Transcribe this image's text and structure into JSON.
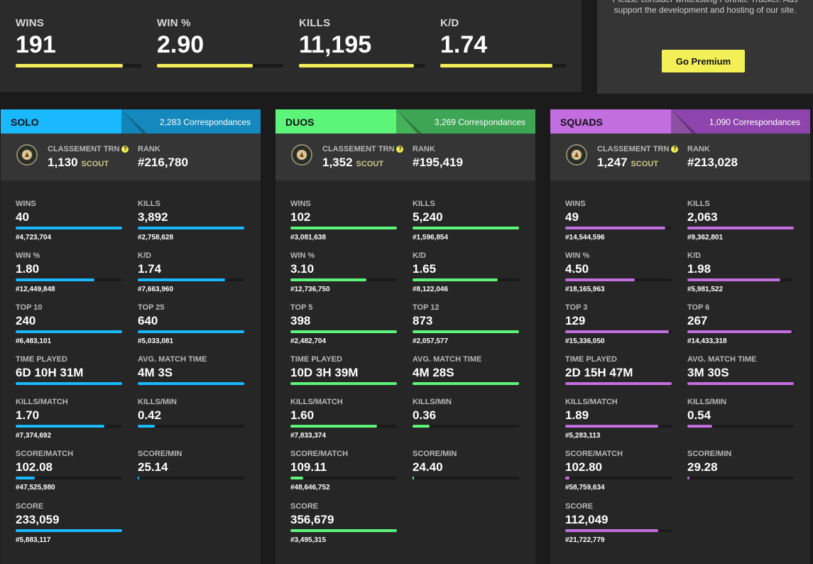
{
  "top": {
    "stats": [
      {
        "label": "WINS",
        "value": "191",
        "fill": 0.85
      },
      {
        "label": "WIN %",
        "value": "2.90",
        "fill": 0.76
      },
      {
        "label": "KILLS",
        "value": "11,195",
        "fill": 0.91
      },
      {
        "label": "K/D",
        "value": "1.74",
        "fill": 0.89
      }
    ]
  },
  "ad": {
    "text": "Please consider whitelisting Fortnite Tracker. Ads support the development and hosting of our site.",
    "button": "Go Premium"
  },
  "modes": [
    {
      "title": "SOLO",
      "count": "2,283 Correspondances",
      "color": "#19b8ff",
      "ribbon": "#1589bd",
      "trn_label": "CLASSEMENT TRN",
      "trn_value": "1,130",
      "trn_tier": "SCOUT",
      "rank_label": "RANK",
      "rank_value": "#216,780",
      "stats": [
        {
          "label": "WINS",
          "value": "40",
          "rank": "#4,723,704",
          "fill": 1.0
        },
        {
          "label": "KILLS",
          "value": "3,892",
          "rank": "#2,758,628",
          "fill": 1.0
        },
        {
          "label": "WIN %",
          "value": "1.80",
          "rank": "#12,449,848",
          "fill": 0.74
        },
        {
          "label": "K/D",
          "value": "1.74",
          "rank": "#7,663,960",
          "fill": 0.82
        },
        {
          "label": "TOP 10",
          "value": "240",
          "rank": "#6,483,101",
          "fill": 1.0
        },
        {
          "label": "TOP 25",
          "value": "640",
          "rank": "#5,033,081",
          "fill": 1.0
        },
        {
          "label": "TIME PLAYED",
          "value": "6D 10H 31M",
          "rank": "",
          "fill": 1.0
        },
        {
          "label": "AVG. MATCH TIME",
          "value": "4M 3S",
          "rank": "",
          "fill": 1.0
        },
        {
          "label": "KILLS/MATCH",
          "value": "1.70",
          "rank": "#7,374,692",
          "fill": 0.83
        },
        {
          "label": "KILLS/MIN",
          "value": "0.42",
          "rank": "",
          "fill": 0.16
        },
        {
          "label": "SCORE/MATCH",
          "value": "102.08",
          "rank": "#47,525,980",
          "fill": 0.18
        },
        {
          "label": "SCORE/MIN",
          "value": "25.14",
          "rank": "",
          "fill": 0.01
        },
        {
          "label": "SCORE",
          "value": "233,059",
          "rank": "#5,883,117",
          "fill": 1.0
        }
      ]
    },
    {
      "title": "DUOS",
      "count": "3,269 Correspondances",
      "color": "#5cf57a",
      "ribbon": "#3ea555",
      "trn_label": "CLASSEMENT TRN",
      "trn_value": "1,352",
      "trn_tier": "SCOUT",
      "rank_label": "RANK",
      "rank_value": "#195,419",
      "stats": [
        {
          "label": "WINS",
          "value": "102",
          "rank": "#3,081,638",
          "fill": 1.0
        },
        {
          "label": "KILLS",
          "value": "5,240",
          "rank": "#1,596,854",
          "fill": 1.0
        },
        {
          "label": "WIN %",
          "value": "3.10",
          "rank": "#12,736,750",
          "fill": 0.71
        },
        {
          "label": "K/D",
          "value": "1.65",
          "rank": "#8,122,046",
          "fill": 0.8
        },
        {
          "label": "TOP 5",
          "value": "398",
          "rank": "#2,482,704",
          "fill": 1.0
        },
        {
          "label": "TOP 12",
          "value": "873",
          "rank": "#2,057,577",
          "fill": 1.0
        },
        {
          "label": "TIME PLAYED",
          "value": "10D 3H 39M",
          "rank": "",
          "fill": 1.0
        },
        {
          "label": "AVG. MATCH TIME",
          "value": "4M 28S",
          "rank": "",
          "fill": 1.0
        },
        {
          "label": "KILLS/MATCH",
          "value": "1.60",
          "rank": "#7,833,374",
          "fill": 0.81
        },
        {
          "label": "KILLS/MIN",
          "value": "0.36",
          "rank": "",
          "fill": 0.16
        },
        {
          "label": "SCORE/MATCH",
          "value": "109.11",
          "rank": "#48,646,752",
          "fill": 0.12
        },
        {
          "label": "SCORE/MIN",
          "value": "24.40",
          "rank": "",
          "fill": 0.01
        },
        {
          "label": "SCORE",
          "value": "356,679",
          "rank": "#3,495,315",
          "fill": 1.0
        }
      ]
    },
    {
      "title": "SQUADS",
      "count": "1,090 Correspondances",
      "color": "#c36ee0",
      "ribbon": "#8e44ad",
      "trn_label": "CLASSEMENT TRN",
      "trn_value": "1,247",
      "trn_tier": "SCOUT",
      "rank_label": "RANK",
      "rank_value": "#213,028",
      "stats": [
        {
          "label": "WINS",
          "value": "49",
          "rank": "#14,544,596",
          "fill": 0.94
        },
        {
          "label": "KILLS",
          "value": "2,063",
          "rank": "#9,362,801",
          "fill": 1.0
        },
        {
          "label": "WIN %",
          "value": "4.50",
          "rank": "#18,165,963",
          "fill": 0.65
        },
        {
          "label": "K/D",
          "value": "1.98",
          "rank": "#5,981,522",
          "fill": 0.87
        },
        {
          "label": "TOP 3",
          "value": "129",
          "rank": "#15,336,050",
          "fill": 0.97
        },
        {
          "label": "TOP 6",
          "value": "267",
          "rank": "#14,433,318",
          "fill": 0.98
        },
        {
          "label": "TIME PLAYED",
          "value": "2D 15H 47M",
          "rank": "",
          "fill": 1.0
        },
        {
          "label": "AVG. MATCH TIME",
          "value": "3M 30S",
          "rank": "",
          "fill": 1.0
        },
        {
          "label": "KILLS/MATCH",
          "value": "1.89",
          "rank": "#5,283,113",
          "fill": 0.87
        },
        {
          "label": "KILLS/MIN",
          "value": "0.54",
          "rank": "",
          "fill": 0.23
        },
        {
          "label": "SCORE/MATCH",
          "value": "102.80",
          "rank": "#58,759,634",
          "fill": 0.04
        },
        {
          "label": "SCORE/MIN",
          "value": "29.28",
          "rank": "",
          "fill": 0.02
        },
        {
          "label": "SCORE",
          "value": "112,049",
          "rank": "#21,722,779",
          "fill": 0.87
        }
      ]
    }
  ]
}
